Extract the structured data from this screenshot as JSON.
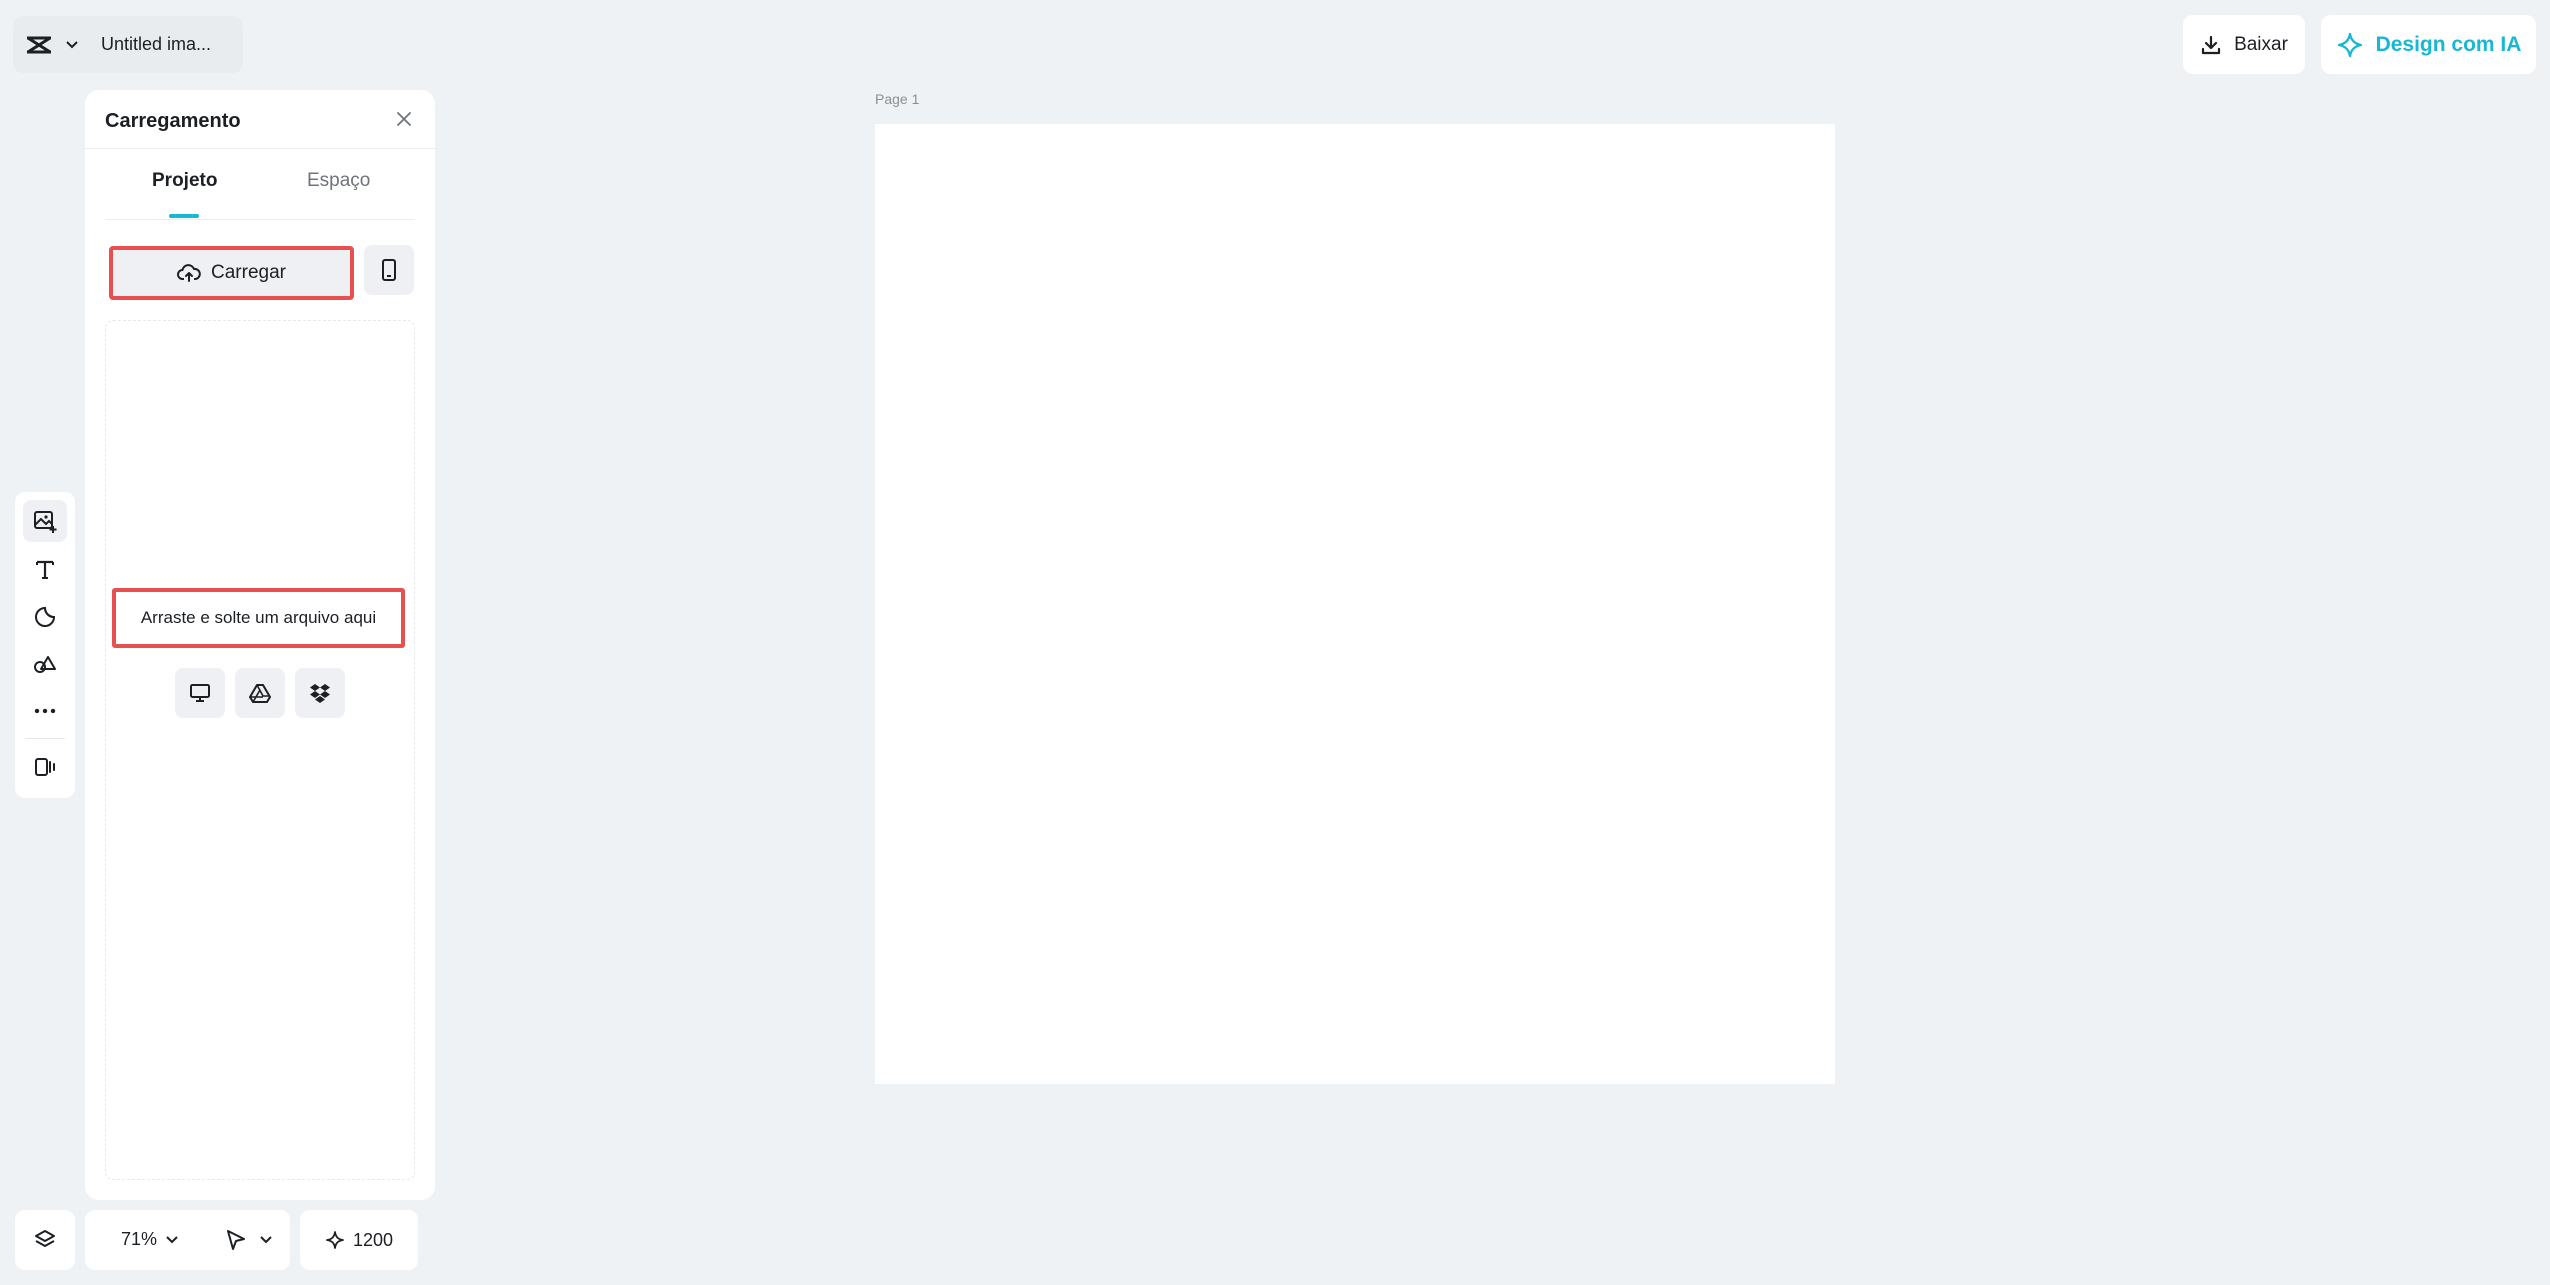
{
  "header": {
    "title": "Untitled ima...",
    "download_label": "Baixar",
    "ai_label": "Design com IA"
  },
  "toolbar": {
    "tools": [
      "upload-image",
      "text",
      "elements",
      "shapes",
      "more",
      "layout"
    ]
  },
  "panel": {
    "title": "Carregamento",
    "tabs": [
      {
        "label": "Projeto",
        "active": true
      },
      {
        "label": "Espaço",
        "active": false
      }
    ],
    "upload_label": "Carregar",
    "drop_text": "Arraste e solte um arquivo aqui",
    "sources": [
      "computer-icon",
      "google-drive-icon",
      "dropbox-icon"
    ]
  },
  "canvas": {
    "page_label": "Page 1"
  },
  "bottom": {
    "zoom": "71%",
    "credits": "1200"
  },
  "colors": {
    "accent": "#18b8d4",
    "highlight": "#e85050",
    "background": "#eff2f5"
  }
}
